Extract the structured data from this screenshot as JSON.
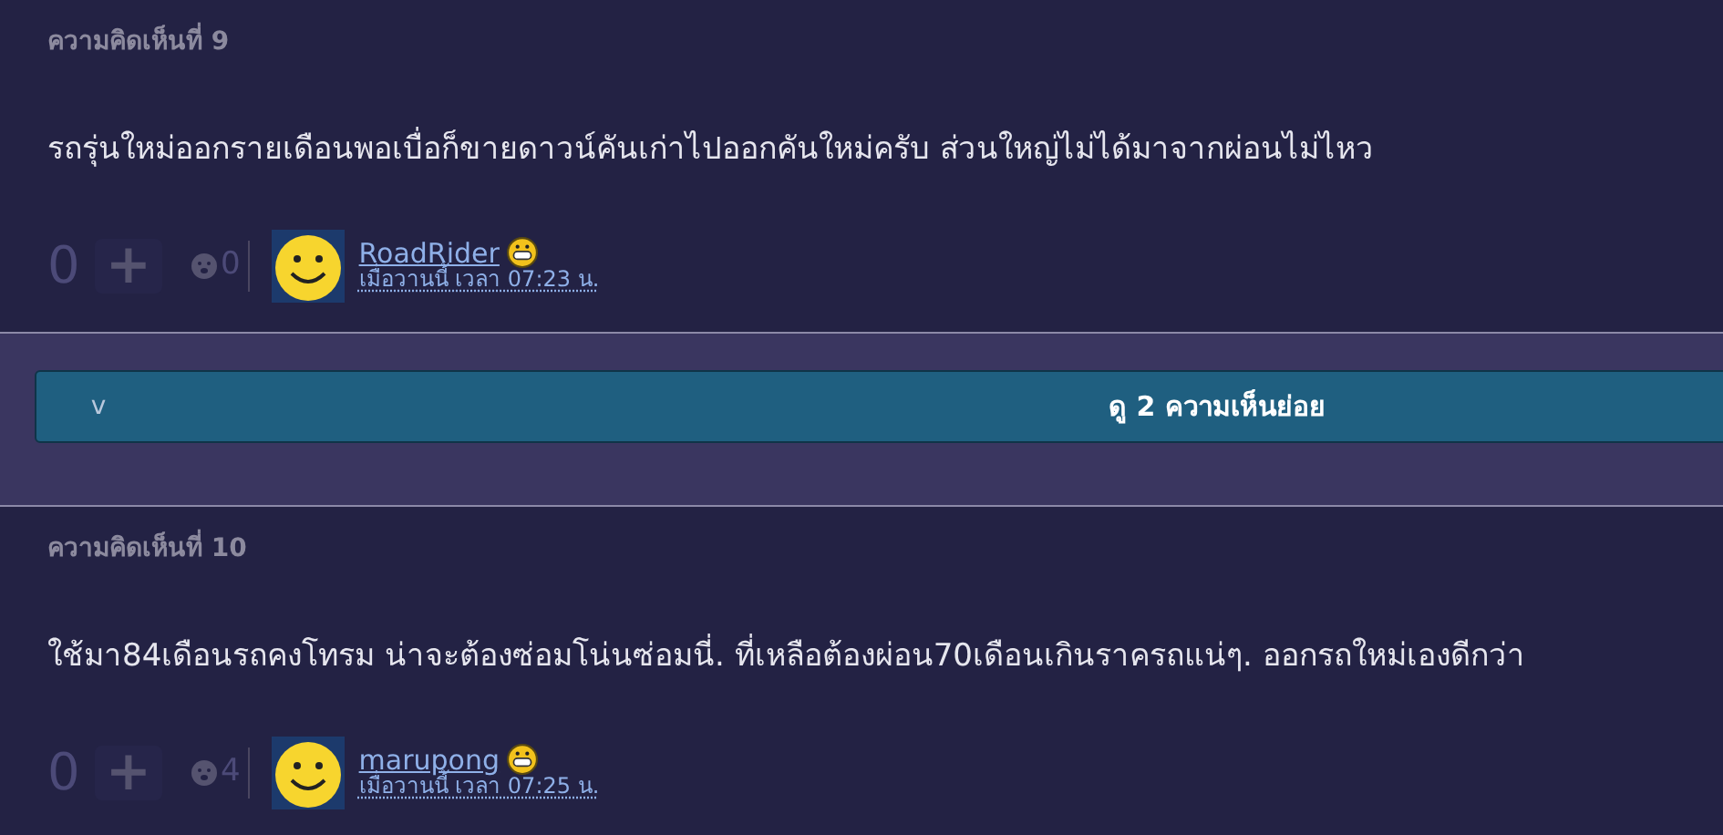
{
  "sections": [
    {
      "kind": "comment",
      "header": "ความคิดเห็นที่ 9",
      "body": "รถรุ่นใหม่ออกรายเดือนพอเบื่อก็ขายดาวน์คันเก่าไปออกคันใหม่ครับ ส่วนใหญ่ไม่ได้มาจากผ่อนไม่ไหว",
      "score": "0",
      "plus": "+",
      "emotion_count": "0",
      "username": "RoadRider",
      "time": "เมื่อวานนี้ เวลา 07:23 น."
    },
    {
      "kind": "replies",
      "toggle": "v",
      "label": "ดู 2 ความเห็นย่อย"
    },
    {
      "kind": "comment",
      "header": "ความคิดเห็นที่ 10",
      "body": "ใช้มา84เดือนรถคงโทรม น่าจะต้องซ่อมโน่นซ่อมนี่.  ที่เหลือต้องผ่อน70เดือนเกินราครถแน่ๆ. ออกรถใหม่เองดีกว่า",
      "score": "0",
      "plus": "+",
      "emotion_count": "4",
      "username": "marupong",
      "time": "เมื่อวานนี้ เวลา 07:25 น."
    }
  ]
}
